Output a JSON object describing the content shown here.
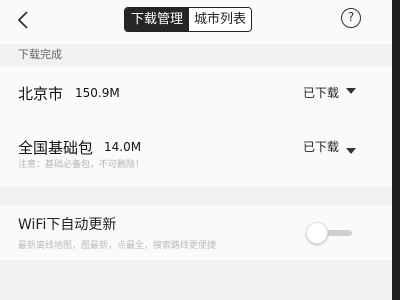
{
  "header": {
    "tabs": [
      {
        "label": "下载管理",
        "active": true
      },
      {
        "label": "城市列表",
        "active": false
      }
    ],
    "help_glyph": "?"
  },
  "section": {
    "download_complete": "下载完成"
  },
  "downloads": [
    {
      "name": "北京市",
      "size": "150.9M",
      "status": "已下载"
    },
    {
      "name": "全国基础包",
      "size": "14.0M",
      "status": "已下载",
      "note": "注意：基础必备包，不可删除！"
    }
  ],
  "wifi_setting": {
    "title": "WiFi下自动更新",
    "description": "最新离线地图，图最新，点最全，搜索路线更便捷",
    "enabled": false
  },
  "colors": {
    "accent_dark": "#262626",
    "background": "#f1f1f1",
    "row_background": "#fafafa"
  }
}
